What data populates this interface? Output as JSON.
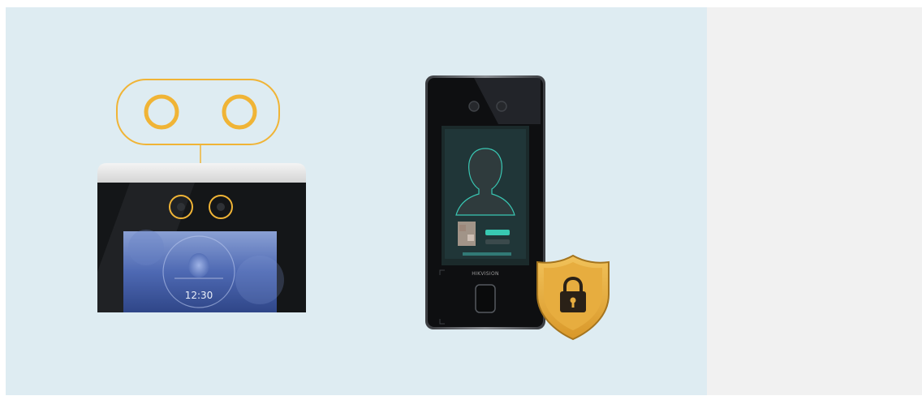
{
  "illustrations": {
    "left": {
      "name": "dual-lens-face-terminal",
      "accent": "#f0b436",
      "screen_time": "12:30"
    },
    "right": {
      "name": "fingerprint-face-terminal",
      "badge_icon": "lock-icon",
      "badge_color": "#e0a93a",
      "brand_text": "HIKVISION"
    }
  },
  "colors": {
    "panel_left": "#deecf2",
    "panel_right": "#f1f1f1"
  }
}
